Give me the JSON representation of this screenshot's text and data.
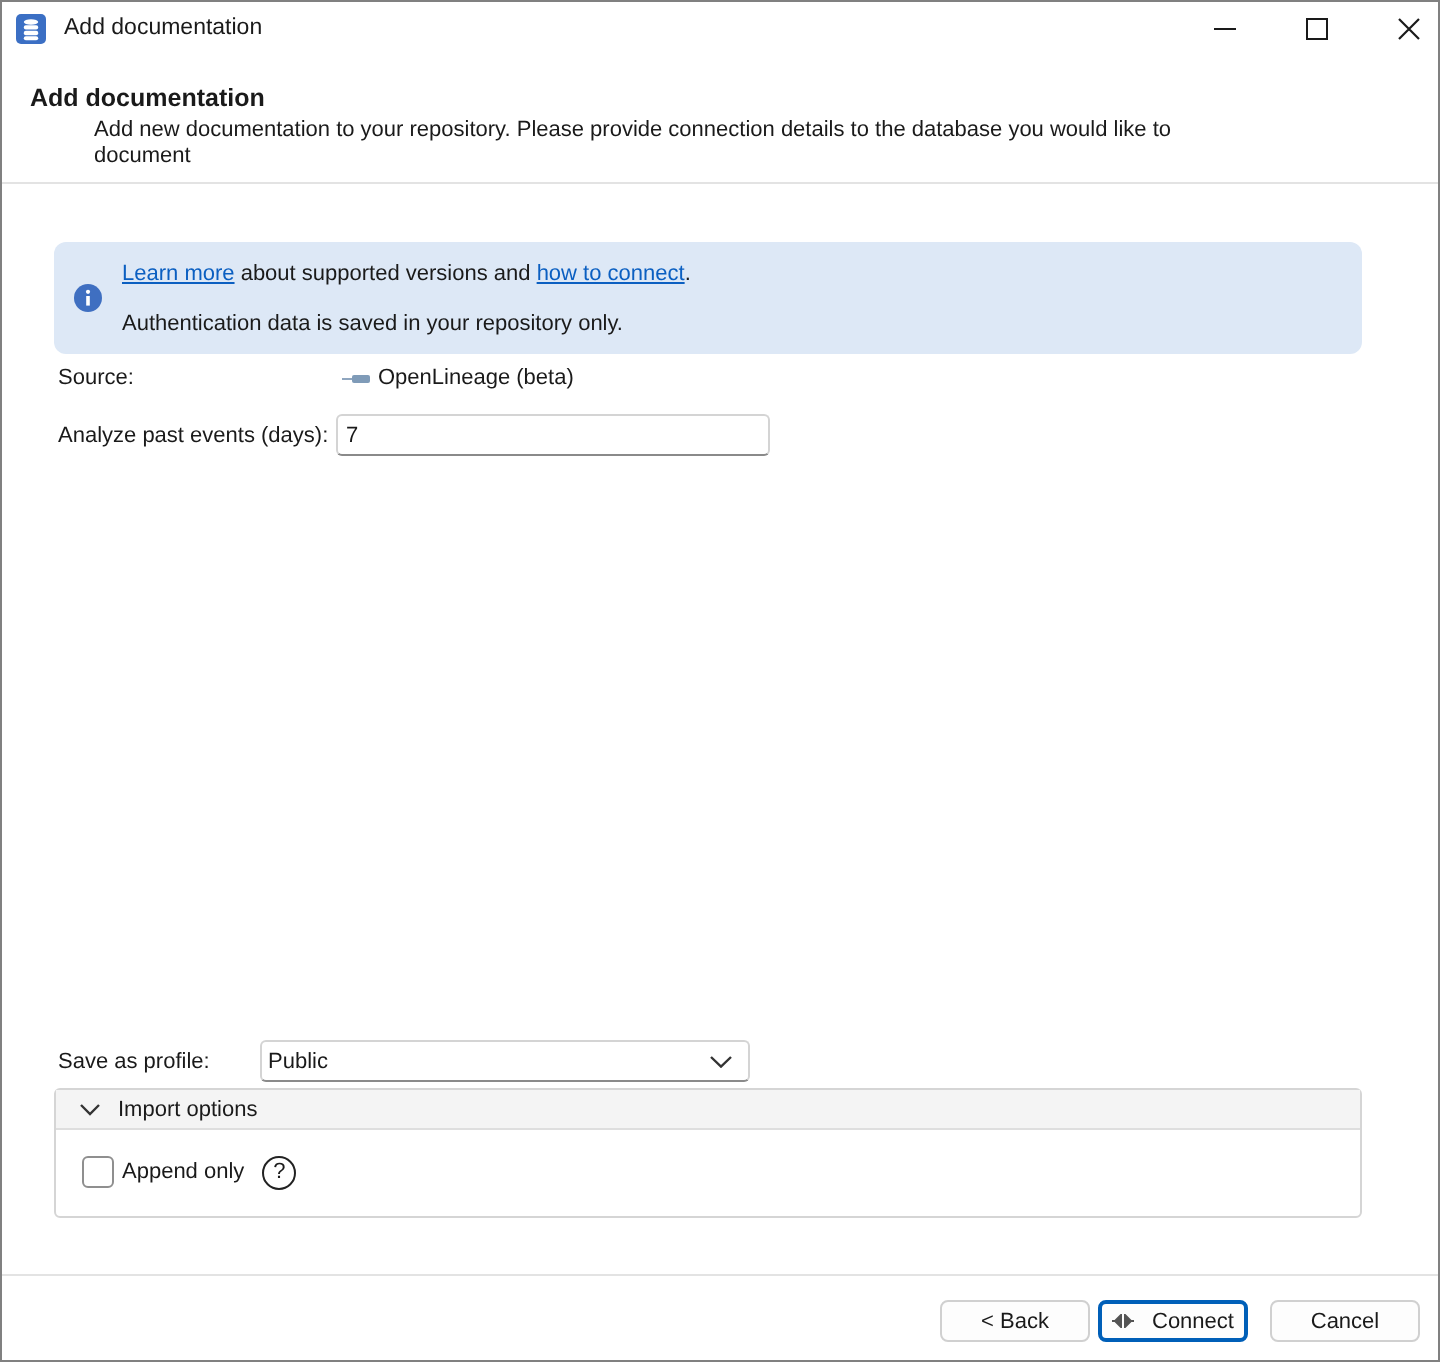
{
  "window": {
    "title": "Add documentation"
  },
  "header": {
    "title": "Add documentation",
    "description": "Add new documentation to your repository. Please provide connection details to the database you would like to document"
  },
  "notice": {
    "lines": [
      {
        "parts": [
          {
            "kind": "link",
            "text": "Learn more"
          },
          {
            "kind": "text",
            "text": " about supported versions and "
          },
          {
            "kind": "link",
            "text": "how to connect"
          },
          {
            "kind": "text",
            "text": "."
          }
        ]
      },
      {
        "parts": [
          {
            "kind": "text",
            "text": "Authentication data is saved in your repository only."
          }
        ]
      }
    ]
  },
  "source": {
    "label": "Source:",
    "value": "OpenLineage (beta)"
  },
  "fields": [
    {
      "label": "Analyze past events (days):",
      "value": "7"
    }
  ],
  "profile": {
    "label": "Save as profile:",
    "value": "Public"
  },
  "import_options": {
    "title": "Import options",
    "expanded": true,
    "options": [
      {
        "label": "Append only",
        "checked": false,
        "help": "?"
      }
    ]
  },
  "buttons": [
    {
      "label": "< Back",
      "kind": "plain",
      "focused": false
    },
    {
      "label": "Connect",
      "kind": "connect",
      "focused": true
    },
    {
      "label": "Cancel",
      "kind": "plain",
      "focused": false
    }
  ]
}
